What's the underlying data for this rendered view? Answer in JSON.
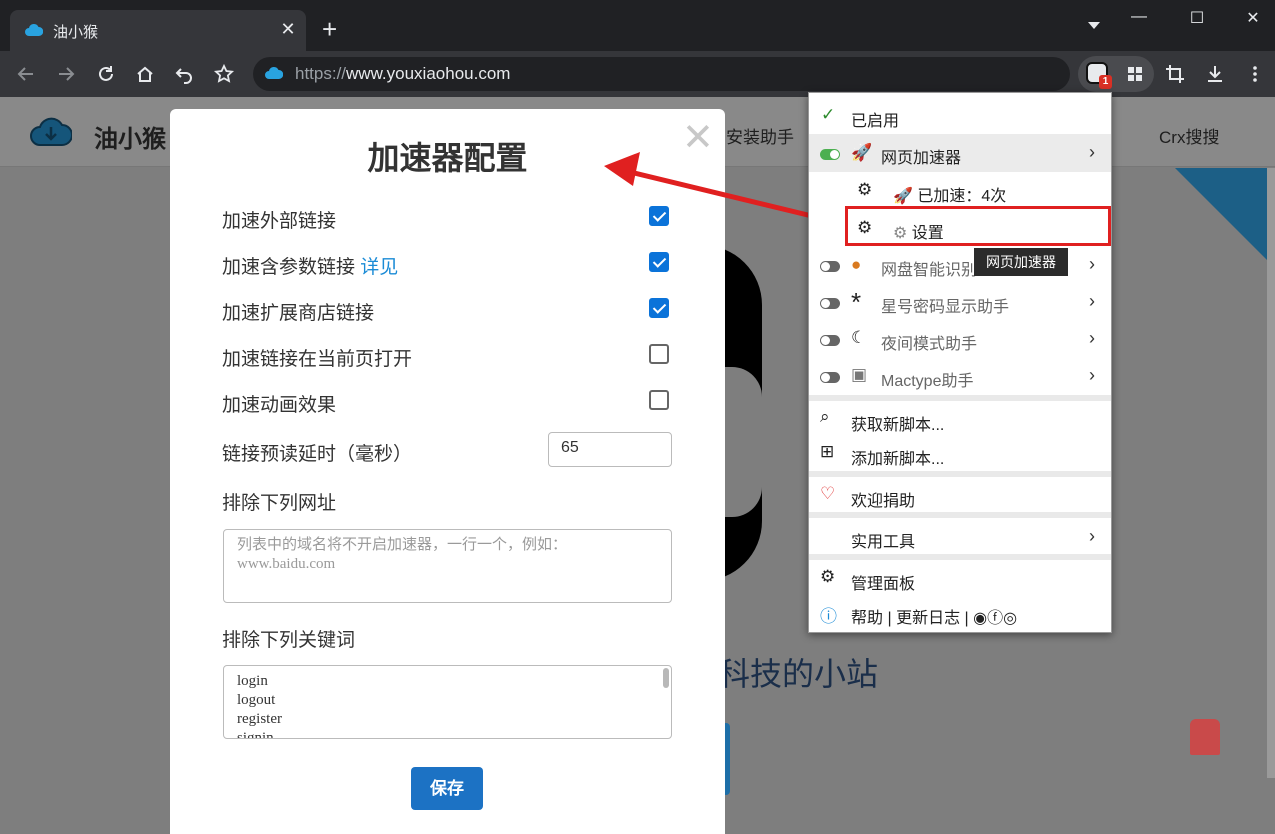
{
  "browser": {
    "tab_title": "油小猴",
    "tab_close": "✕",
    "new_tab": "+",
    "url_prefix": "https://",
    "url_host": "www.youxiaohou.com",
    "ext_badge": "1",
    "win_min": "—",
    "win_max": "☐",
    "win_close": "✕"
  },
  "site": {
    "name": "油小猴",
    "nav": [
      "安装助手",
      "Crx搜搜"
    ],
    "headline": "科技的小站"
  },
  "modal": {
    "close": "✕",
    "title": "加速器配置",
    "options": [
      {
        "label": "加速外部链接",
        "checked": true
      },
      {
        "label": "加速含参数链接",
        "link": "详见",
        "checked": true
      },
      {
        "label": "加速扩展商店链接",
        "checked": true
      },
      {
        "label": "加速链接在当前页打开",
        "checked": false
      },
      {
        "label": "加速动画效果",
        "checked": false
      }
    ],
    "delay_label": "链接预读延时（毫秒）",
    "delay_value": "65",
    "exclude_urls_label": "排除下列网址",
    "exclude_urls_placeholder": "列表中的域名将不开启加速器，一行一个，例如：\nwww.baidu.com",
    "exclude_keywords_label": "排除下列关键词",
    "exclude_keywords_value": "login\nlogout\nregister\nsignin",
    "save": "保存"
  },
  "menu": {
    "enabled": "已启用",
    "scripts": [
      {
        "name": "网页加速器",
        "on": true
      },
      {
        "name": "网盘智能识别",
        "on": false
      },
      {
        "name": "星号密码显示助手",
        "on": false
      },
      {
        "name": "夜间模式助手",
        "on": false
      },
      {
        "name": "Mactype助手",
        "on": false
      }
    ],
    "accelerated": "已加速：4次",
    "settings": "设置",
    "tooltip": "网页加速器",
    "get_new": "获取新脚本...",
    "add_new": "添加新脚本...",
    "donate": "欢迎捐助",
    "tools": "实用工具",
    "dashboard": "管理面板",
    "help": "帮助",
    "changelog": "更新日志"
  },
  "colors": {
    "accent": "#1c72c4",
    "highlight": "#e02020",
    "toggle_on": "#4caf50"
  }
}
